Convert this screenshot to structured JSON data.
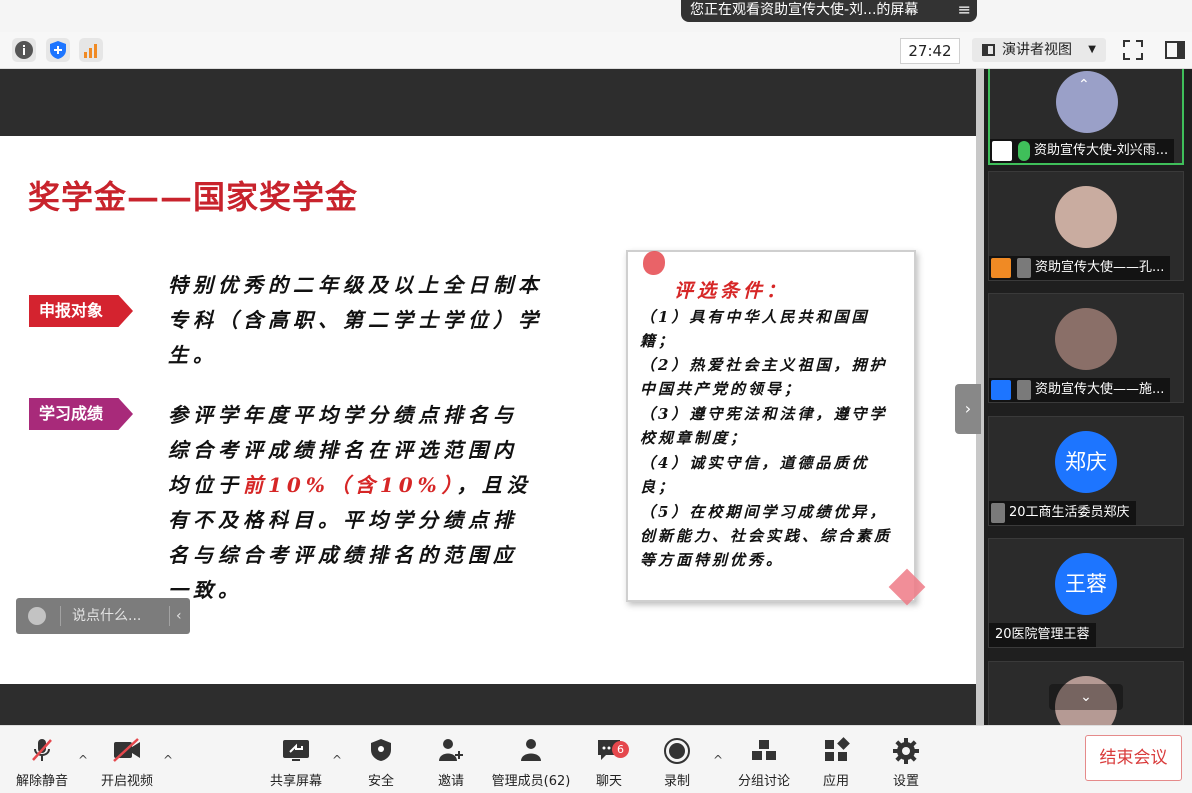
{
  "notice": {
    "text": "您正在观看资助宣传大使-刘...的屏幕",
    "menu_icon": "≡"
  },
  "toolbar": {
    "timer": "27:42",
    "view_label": "演讲者视图"
  },
  "slide": {
    "title": "奖学金——国家奖学金",
    "tag1": "申报对象",
    "para1": "特别优秀的二年级及以上全日制本专科（含高职、第二学士学位）学生。",
    "tag2": "学习成绩",
    "para2_a": "参评学年度平均学分绩点排名与综合考评成绩排名在评选范围内均位于",
    "para2_red": "前10%（含10%）",
    "para2_b": "，且没有不及格科目。平均学分绩点排名与综合考评成绩排名的范围应一致。",
    "card_title": "评选条件：",
    "criteria": [
      "（1）具有中华人民共和国国籍；",
      "（2）热爱社会主义祖国，拥护中国共产党的领导；",
      "（3）遵守宪法和法律，遵守学校规章制度；",
      "（4）诚实守信，道德品质优良；",
      "（5）在校期间学习成绩优异，创新能力、社会实践、综合素质等方面特别优秀。"
    ]
  },
  "chat": {
    "placeholder": "说点什么..."
  },
  "participants": [
    {
      "name": "资助宣传大使-刘兴雨...",
      "avatar_color": "#9aa0c8"
    },
    {
      "name": "资助宣传大使——孔...",
      "avatar_color": "#c9aca0"
    },
    {
      "name": "资助宣传大使——施...",
      "avatar_color": "#8a6f68"
    },
    {
      "name": "20工商生活委员郑庆",
      "initials": "郑庆"
    },
    {
      "name": "20医院管理王蓉",
      "initials": "王蓉"
    }
  ],
  "bottom": {
    "unmute": "解除静音",
    "video": "开启视频",
    "share": "共享屏幕",
    "security": "安全",
    "invite": "邀请",
    "members": "管理成员(62)",
    "chat": "聊天",
    "chat_badge": "6",
    "record": "录制",
    "breakout": "分组讨论",
    "apps": "应用",
    "settings": "设置",
    "end": "结束会议"
  }
}
